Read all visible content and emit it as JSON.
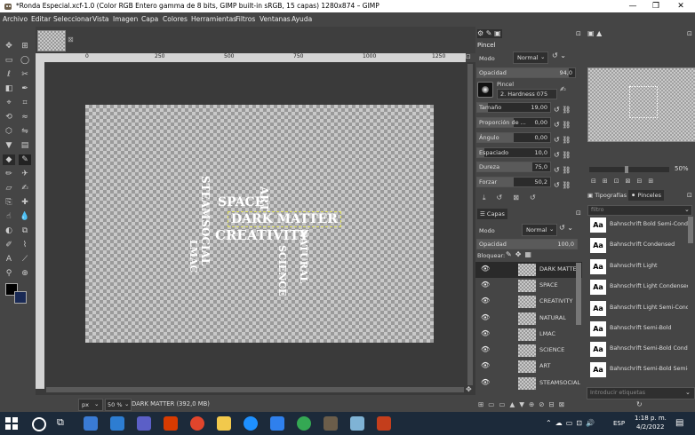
{
  "window": {
    "title": "*Ronda Especial.xcf-1.0 (Color RGB Entero gamma de 8 bits, GIMP built-in sRGB, 15 capas) 1280x874 – GIMP",
    "controls": [
      "—",
      "❐",
      "✕"
    ]
  },
  "menu": [
    "Archivo",
    "Editar",
    "Seleccionar",
    "Vista",
    "Imagen",
    "Capa",
    "Colores",
    "Herramientas",
    "Filtros",
    "Ventanas",
    "Ayuda"
  ],
  "rulers": {
    "h": [
      "0",
      "250",
      "500",
      "750",
      "1000",
      "1250"
    ]
  },
  "canvas_words": {
    "space": "SPACE",
    "art": "ART",
    "dark_matter": "DARK MATTER",
    "creativity": "CREATIVITY",
    "steamsocial": "STEAMSOCIAL",
    "lmac": "LMAC",
    "natural": "NATURAL",
    "science": "SCIENCE"
  },
  "status": {
    "unit": "px",
    "zoom": "50 %",
    "message": "DARK MATTER (392,0 MB)"
  },
  "tool_options": {
    "title": "Pincel",
    "mode_label": "Modo",
    "mode_value": "Normal",
    "opacity_label": "Opacidad",
    "opacity_value": "94,0",
    "brush_label": "Pincel",
    "brush_name": "2. Hardness 075",
    "sliders": [
      {
        "label": "Tamaño",
        "value": "19,00",
        "fill": 0.15
      },
      {
        "label": "Proporción de ...",
        "value": "0,00",
        "fill": 0.5
      },
      {
        "label": "Ángulo",
        "value": "0,00",
        "fill": 0.5
      },
      {
        "label": "Espaciado",
        "value": "10,0",
        "fill": 0.1
      },
      {
        "label": "Dureza",
        "value": "75,0",
        "fill": 0.75
      },
      {
        "label": "Forzar",
        "value": "50,2",
        "fill": 0.5
      }
    ]
  },
  "navigation": {
    "zoom": "50%"
  },
  "layers": {
    "tab": "Capas",
    "mode_label": "Modo",
    "mode_value": "Normal",
    "opacity_label": "Opacidad",
    "opacity_value": "100,0",
    "lock_label": "Bloquear:",
    "items": [
      "DARK MATTER",
      "SPACE",
      "CREATIVITY",
      "NATURAL",
      "LMAC",
      "SCIENCE",
      "ART",
      "STEAMSOCIAL"
    ]
  },
  "fonts_panel": {
    "tab_fonts": "Tipografías",
    "tab_brushes": "Pinceles",
    "filter_placeholder": "filtro",
    "tags_placeholder": "Introducir etiquetas",
    "items": [
      "Bahnschrift Bold Semi-Condensed",
      "Bahnschrift Condensed",
      "Bahnschrift Light",
      "Bahnschrift Light Condensed",
      "Bahnschrift Light Semi-Condensed",
      "Bahnschrift Semi-Bold",
      "Bahnschrift Semi-Bold Condensed",
      "Bahnschrift Semi-Bold Semi-Condensed"
    ],
    "aa": "Aa"
  },
  "taskbar": {
    "time": "1:18 p. m.",
    "date": "4/2/2022",
    "lang": "ESP",
    "colors": {
      "bg": "#1c2a3a",
      "accent": "#2d7dd2"
    }
  }
}
